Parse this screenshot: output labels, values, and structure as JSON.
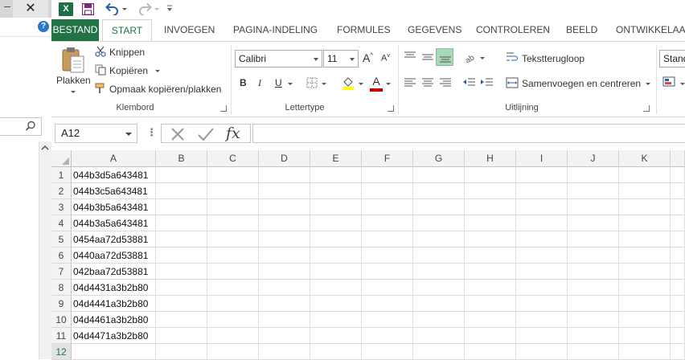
{
  "left_window": {
    "minimize_glyph": "–",
    "close_glyph": "✕",
    "help_glyph": "?"
  },
  "app": {
    "logo_letter": "X"
  },
  "ribbon_tabs": [
    "BESTAND",
    "START",
    "INVOEGEN",
    "PAGINA-INDELING",
    "FORMULES",
    "GEGEVENS",
    "CONTROLEREN",
    "BEELD",
    "ONTWIKKELAARS"
  ],
  "ribbon": {
    "clipboard": {
      "paste": "Plakken",
      "cut": "Knippen",
      "copy": "Kopiëren",
      "format_painter": "Opmaak kopiëren/plakken",
      "group": "Klembord"
    },
    "font": {
      "name": "Calibri",
      "size": "11",
      "grow": "A",
      "shrink": "A",
      "bold": "B",
      "italic": "I",
      "underline": "U",
      "font_color_letter": "A",
      "highlight_color": "#ffff00",
      "font_color": "#c00000",
      "group": "Lettertype"
    },
    "alignment": {
      "wrap_text": "Tekstterugloop",
      "merge_center": "Samenvoegen en centreren",
      "group": "Uitlijning"
    },
    "styles": {
      "style_box": "Stand"
    }
  },
  "formula_bar": {
    "name_box": "A12",
    "dots": "⋮",
    "fx": "fx",
    "content": ""
  },
  "sheet": {
    "columns": [
      "A",
      "B",
      "C",
      "D",
      "E",
      "F",
      "G",
      "H",
      "I",
      "J",
      "K"
    ],
    "rows": [
      "1",
      "2",
      "3",
      "4",
      "5",
      "6",
      "7",
      "8",
      "9",
      "10",
      "11",
      "12"
    ],
    "column_a_values": [
      "044b3d5a643481",
      "044b3c5a643481",
      "044b3b5a643481",
      "044b3a5a643481",
      "0454aa72d53881",
      "0440aa72d53881",
      "042baa72d53881",
      "04d4431a3b2b80",
      "04d4441a3b2b80",
      "04d4461a3b2b80",
      "04d4471a3b2b80",
      ""
    ],
    "selected_row": "12"
  },
  "colors": {
    "excel_green": "#217346",
    "paste_clipboard": "#c89b5a",
    "help_blue": "#2b78c7"
  }
}
